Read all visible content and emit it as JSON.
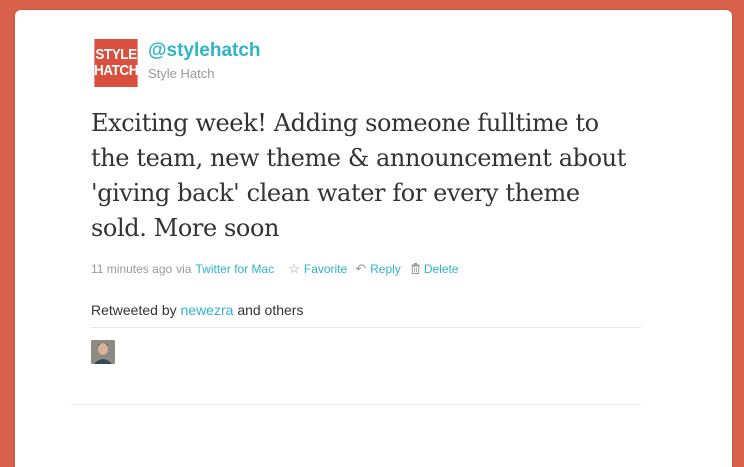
{
  "brand": {
    "logo_line1": "STYLE",
    "logo_line2": "HATCH",
    "logo_color": "#d9503e"
  },
  "user": {
    "handle": "@stylehatch",
    "name": "Style Hatch"
  },
  "tweet": {
    "text": "Exciting week! Adding someone fulltime to the team, new theme & announcement about 'giving back' clean water for every theme sold. More soon",
    "time": "11 minutes ago",
    "via_prefix": "via",
    "client": "Twitter for Mac"
  },
  "actions": {
    "favorite": "Favorite",
    "reply": "Reply",
    "delete": "Delete"
  },
  "retweet": {
    "prefix": "Retweeted by",
    "user": "newezra",
    "suffix": "and others"
  },
  "colors": {
    "background": "#d9604a",
    "link": "#2fb4c8",
    "text": "#333333",
    "muted": "#999999"
  }
}
